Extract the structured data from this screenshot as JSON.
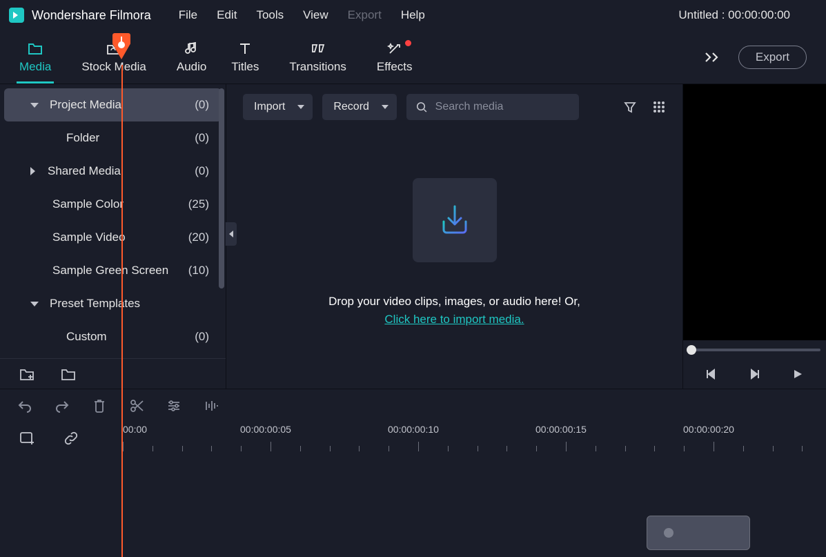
{
  "app": {
    "title": "Wondershare Filmora",
    "project_title": "Untitled : 00:00:00:00"
  },
  "menu": {
    "file": "File",
    "edit": "Edit",
    "tools": "Tools",
    "view": "View",
    "export": "Export",
    "help": "Help"
  },
  "tabs": {
    "media": "Media",
    "stock": "Stock Media",
    "audio": "Audio",
    "titles": "Titles",
    "transitions": "Transitions",
    "effects": "Effects",
    "export_btn": "Export"
  },
  "sidebar": {
    "items": [
      {
        "label": "Project Media",
        "count": "(0)"
      },
      {
        "label": "Folder",
        "count": "(0)"
      },
      {
        "label": "Shared Media",
        "count": "(0)"
      },
      {
        "label": "Sample Color",
        "count": "(25)"
      },
      {
        "label": "Sample Video",
        "count": "(20)"
      },
      {
        "label": "Sample Green Screen",
        "count": "(10)"
      },
      {
        "label": "Preset Templates",
        "count": ""
      },
      {
        "label": "Custom",
        "count": "(0)"
      }
    ]
  },
  "content": {
    "import_label": "Import",
    "record_label": "Record",
    "search_placeholder": "Search media",
    "drop_text": "Drop your video clips, images, or audio here! Or,",
    "drop_link": "Click here to import media."
  },
  "timeline": {
    "labels": [
      "00:00",
      "00:00:00:05",
      "00:00:00:10",
      "00:00:00:15",
      "00:00:00:20"
    ]
  }
}
